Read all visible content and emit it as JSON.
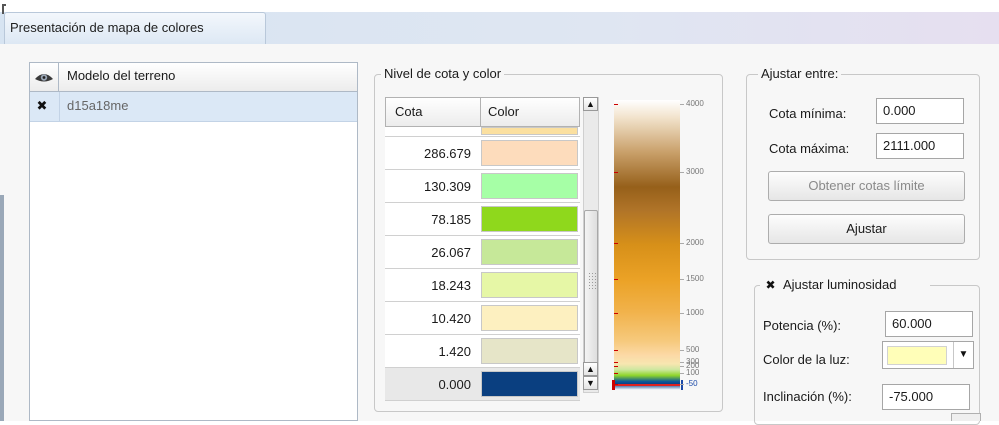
{
  "window": {
    "title": "Presentación de mapa de colores"
  },
  "layers": {
    "header": "Modelo del terreno",
    "rows": [
      {
        "checked_glyph": "✖",
        "name": "d15a18me"
      }
    ]
  },
  "levels_group": {
    "title": "Nivel de cota y color",
    "columns": {
      "cota": "Cota",
      "color": "Color"
    },
    "rows": [
      {
        "cota": "286.679",
        "color": "#fddcbc"
      },
      {
        "cota": "130.309",
        "color": "#a6ffa6"
      },
      {
        "cota": "78.185",
        "color": "#8fd81c"
      },
      {
        "cota": "26.067",
        "color": "#c6e899"
      },
      {
        "cota": "18.243",
        "color": "#e6f7a6"
      },
      {
        "cota": "10.420",
        "color": "#fdf0c0"
      },
      {
        "cota": "1.420",
        "color": "#e6e5c8"
      },
      {
        "cota": "0.000",
        "color": "#0a3f80"
      }
    ],
    "partial_top_color": "#fbe0a0",
    "ramp_labels": [
      "4000",
      "3000",
      "2000",
      "1500",
      "1000",
      "500",
      "300",
      "200",
      "100",
      "-50"
    ]
  },
  "range_group": {
    "title": "Ajustar entre:",
    "min_label": "Cota mínima:",
    "min_value": "0.000",
    "max_label": "Cota máxima:",
    "max_value": "2111.000",
    "get_limits_button": "Obtener cotas límite",
    "adjust_button": "Ajustar"
  },
  "luminosity_group": {
    "checked": true,
    "title": "Ajustar luminosidad",
    "power_label": "Potencia (%):",
    "power_value": "60.000",
    "light_color_label": "Color de la luz:",
    "light_color": "#fffeb8",
    "tilt_label": "Inclinación (%):",
    "tilt_value": "-75.000"
  }
}
